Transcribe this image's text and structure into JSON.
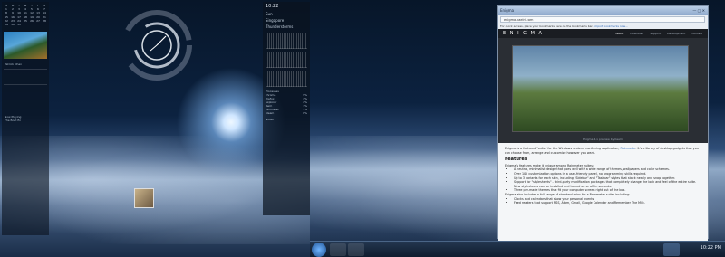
{
  "calendar": {
    "days": [
      "S",
      "M",
      "T",
      "W",
      "T",
      "F",
      "S"
    ],
    "dates": [
      "1",
      "2",
      "3",
      "4",
      "5",
      "6",
      "7",
      "8",
      "9",
      "10",
      "11",
      "12",
      "13",
      "14",
      "15",
      "16",
      "17",
      "18",
      "19",
      "20",
      "21",
      "22",
      "23",
      "24",
      "25",
      "26",
      "27",
      "28",
      "29",
      "30",
      "31"
    ]
  },
  "left_sidebar": {
    "author": "Patrick Ohan",
    "media": {
      "status": "Now Playing",
      "track": "The Boat fin"
    }
  },
  "mid_sidebar": {
    "time": "10:22",
    "day": "Sun",
    "weather_city": "Singapore",
    "weather_cond": "Thunderstorms",
    "processes_title": "Processes",
    "processes": [
      {
        "name": "chrome",
        "value": "9%"
      },
      {
        "name": "firefox",
        "value": "4%"
      },
      {
        "name": "explorer",
        "value": "2%"
      },
      {
        "name": "dwm",
        "value": "1%"
      },
      {
        "name": "rainmeter",
        "value": "1%"
      },
      {
        "name": "steam",
        "value": "0%"
      }
    ],
    "notes_title": "Notes"
  },
  "taskbar": {
    "clock": "10:22 PM"
  },
  "browser": {
    "tab_title": "Enigma",
    "address": "enigma.kaelri.com",
    "bookmarks_hint": "For quick access, place your bookmarks here on the bookmarks bar.",
    "bookmarks_link": "Import bookmarks now...",
    "logo": "E N I G M A",
    "nav": [
      "About",
      "Download",
      "Support",
      "Development",
      "Contact"
    ],
    "hero_caption": "Enigma 4.x preview by Kaelri",
    "intro_prefix": "Enigma is a featured \"suite\" for the Windows system monitoring application,",
    "intro_link": "Rainmeter",
    "intro_suffix": ". It's a library of desktop gadgets that you can choose from, arrange and customize however you want.",
    "features_heading": "Features",
    "features_lead": "Enigma's features make it unique among Rainmeter suites:",
    "features": [
      "A neutral, minimalist design that goes well with a wide range of themes, wallpapers and color schemes.",
      "Over 100 customization options in a user-friendly panel, no programming skills required.",
      "Up to 3 variants for each skin, including \"Sidebar\" and \"Taskbar\" styles that stack neatly and snap together.",
      "Support for \"stylesheets\" - third-party modification packages that completely change the look and feel of the entire suite. New stylesheets can be installed and turned on or off in seconds.",
      "Three pre-made themes that fit your computer screen right out of the box."
    ],
    "includes_lead": "Enigma also includes a full range of standard skins for a Rainmeter suite, including:",
    "includes": [
      "Clocks and calendars that show your personal events.",
      "Feed readers that support RSS, Atom, Gmail, Google Calendar and Remember The Milk."
    ]
  }
}
